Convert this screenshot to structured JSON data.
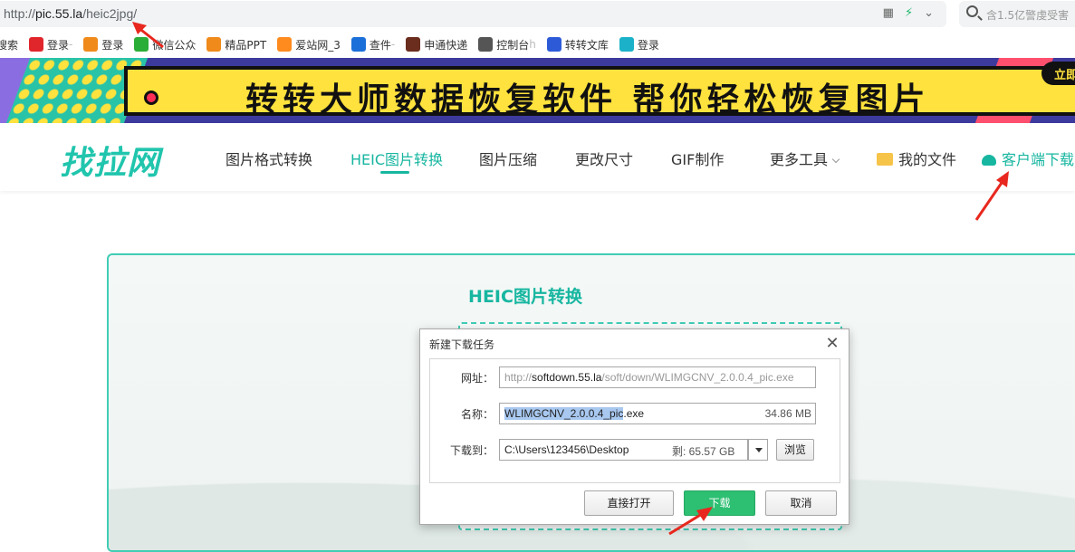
{
  "browser": {
    "url_prefix": "http://",
    "url_host": "pic.55.la",
    "url_path": "/heic2jpg/",
    "search_placeholder": "含1.5亿警虔受害",
    "bookmarks": [
      {
        "icon": "search-icon",
        "label": "搜索",
        "color": "#ffffff"
      },
      {
        "icon": "thumb-up-icon",
        "label": "登录",
        "faded": " -",
        "color": "#e0262b"
      },
      {
        "icon": "55-logo-icon",
        "label": "登录",
        "color": "#f08a1b"
      },
      {
        "icon": "wechat-icon",
        "label": "微信公众",
        "color": "#2aae37"
      },
      {
        "icon": "55-logo-icon",
        "label": "精品PPT",
        "color": "#f08a1b"
      },
      {
        "icon": "aizhan-icon",
        "label": "爱站网_3",
        "color": "#ff8b1f"
      },
      {
        "icon": "zto-icon",
        "label": "查件",
        "faded": " -",
        "color": "#1b6fd8"
      },
      {
        "icon": "sto-icon",
        "label": "申通快递",
        "color": "#6b2d1e"
      },
      {
        "icon": "gear-icon",
        "label": "控制台",
        "faded": " h",
        "color": "#555555"
      },
      {
        "icon": "z-logo-icon",
        "label": "转转文库",
        "color": "#2d5bd8"
      },
      {
        "icon": "circle-logo-icon",
        "label": "登录",
        "color": "#1bb2c9"
      }
    ]
  },
  "banner": {
    "slogan": "转转大师数据恢复软件   帮你轻松恢复图片",
    "cta": "立即"
  },
  "site": {
    "logo": "找拉网",
    "nav": [
      {
        "label": "图片格式转换"
      },
      {
        "label": "HEIC图片转换"
      },
      {
        "label": "图片压缩"
      },
      {
        "label": "更改尺寸"
      },
      {
        "label": "GIF制作"
      },
      {
        "label": "更多工具"
      },
      {
        "label": "我的文件"
      },
      {
        "label": "客户端下载"
      }
    ]
  },
  "main": {
    "title": "HEIC图片转换"
  },
  "dialog": {
    "title": "新建下载任务",
    "url_label": "网址：",
    "url_part1": "http://",
    "url_part2": "softdown.55.la",
    "url_part3": "/soft/down/WLIMGCNV_2.0.0.4_pic.exe",
    "name_label": "名称：",
    "name_selected": "WLIMGCNV_2.0.0.4_pic",
    "name_ext": ".exe",
    "file_size": "34.86 MB",
    "saveto_label": "下载到：",
    "save_path": "C:\\Users\\123456\\Desktop",
    "remaining": "剩: 65.57 GB",
    "browse_label": "浏览",
    "open_label": "直接打开",
    "download_label": "下载",
    "cancel_label": "取消"
  },
  "colors": {
    "accent": "#17b6a0",
    "download_button": "#2dbf72",
    "annotation": "#e8281e"
  }
}
